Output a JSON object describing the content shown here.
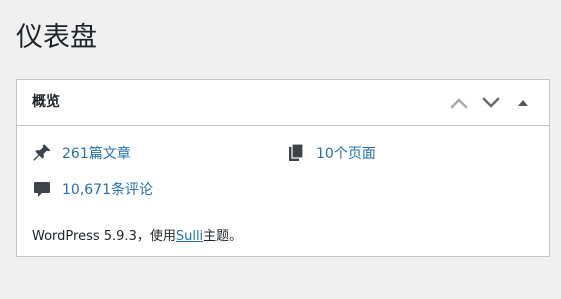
{
  "page": {
    "title": "仪表盘"
  },
  "widget": {
    "title": "概览",
    "controls": {
      "move_up_icon": "chevron-up-icon",
      "move_down_icon": "chevron-down-icon",
      "toggle_icon": "triangle-up-icon"
    },
    "items": {
      "posts": {
        "label": "261篇文章",
        "icon": "pin-icon"
      },
      "pages": {
        "label": "10个页面",
        "icon": "pages-icon"
      },
      "comments": {
        "label": "10,671条评论",
        "icon": "comment-icon"
      }
    },
    "version": {
      "prefix": "WordPress 5.9.3，使用",
      "theme_link": "Sulli",
      "suffix": "主题。"
    }
  },
  "colors": {
    "background": "#f0f0f1",
    "link": "#2271b1",
    "text": "#1d2327",
    "border": "#c3c4c7",
    "icon": "#646970",
    "control_light": "#a7aaad"
  }
}
